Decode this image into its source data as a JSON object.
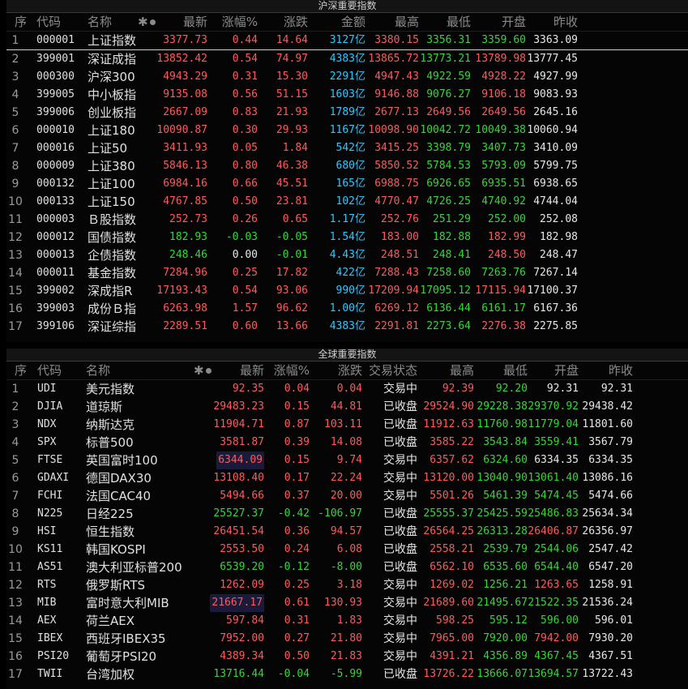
{
  "panel_cn": {
    "title": "沪深重要指数",
    "headers": {
      "seq": "序",
      "code": "代码",
      "name": "名称",
      "star": "✱",
      "last": "最新",
      "pct": "涨幅%",
      "chg": "涨跌",
      "amount": "金额",
      "high": "最高",
      "low": "最低",
      "open": "开盘",
      "prev": "昨收"
    },
    "rows": [
      [
        "1",
        "000001",
        "上证指数",
        "3377.73",
        "0.44",
        "14.64",
        "3127亿",
        "3380.15",
        "3356.31",
        "3359.60",
        "3363.09"
      ],
      [
        "2",
        "399001",
        "深证成指",
        "13852.42",
        "0.54",
        "74.97",
        "4383亿",
        "13865.72",
        "13773.21",
        "13789.98",
        "13777.45"
      ],
      [
        "3",
        "000300",
        "沪深300",
        "4943.29",
        "0.31",
        "15.30",
        "2291亿",
        "4947.43",
        "4922.59",
        "4928.22",
        "4927.99"
      ],
      [
        "4",
        "399005",
        "中小板指",
        "9135.08",
        "0.56",
        "51.15",
        "1603亿",
        "9146.88",
        "9076.27",
        "9106.18",
        "9083.93"
      ],
      [
        "5",
        "399006",
        "创业板指",
        "2667.09",
        "0.83",
        "21.93",
        "1789亿",
        "2677.13",
        "2649.56",
        "2649.56",
        "2645.16"
      ],
      [
        "6",
        "000010",
        "上证180",
        "10090.87",
        "0.30",
        "29.93",
        "1167亿",
        "10098.90",
        "10042.72",
        "10049.38",
        "10060.94"
      ],
      [
        "7",
        "000016",
        "上证50",
        "3411.93",
        "0.05",
        "1.84",
        "542亿",
        "3415.25",
        "3398.79",
        "3407.73",
        "3410.09"
      ],
      [
        "8",
        "000009",
        "上证380",
        "5846.13",
        "0.80",
        "46.38",
        "680亿",
        "5850.52",
        "5784.53",
        "5793.09",
        "5799.75"
      ],
      [
        "9",
        "000132",
        "上证100",
        "6984.16",
        "0.66",
        "45.51",
        "165亿",
        "6988.75",
        "6926.65",
        "6935.51",
        "6938.65"
      ],
      [
        "10",
        "000133",
        "上证150",
        "4767.85",
        "0.50",
        "23.81",
        "102亿",
        "4770.47",
        "4726.25",
        "4740.92",
        "4744.04"
      ],
      [
        "11",
        "000003",
        "Ｂ股指数",
        "252.73",
        "0.26",
        "0.65",
        "1.17亿",
        "252.76",
        "251.29",
        "252.00",
        "252.08"
      ],
      [
        "12",
        "000012",
        "国债指数",
        "182.93",
        "-0.03",
        "-0.05",
        "1.54亿",
        "183.00",
        "182.88",
        "182.99",
        "182.98"
      ],
      [
        "13",
        "000013",
        "企债指数",
        "248.46",
        "0.00",
        "-0.01",
        "4.43亿",
        "248.51",
        "248.41",
        "248.50",
        "248.47"
      ],
      [
        "14",
        "000011",
        "基金指数",
        "7284.96",
        "0.25",
        "17.82",
        "422亿",
        "7288.43",
        "7258.60",
        "7263.76",
        "7267.14"
      ],
      [
        "15",
        "399002",
        "深成指R",
        "17193.43",
        "0.54",
        "93.06",
        "990亿",
        "17209.94",
        "17095.12",
        "17115.94",
        "17100.37"
      ],
      [
        "16",
        "399003",
        "成份Ｂ指",
        "6263.98",
        "1.57",
        "96.62",
        "1.00亿",
        "6269.12",
        "6136.44",
        "6161.17",
        "6167.36"
      ],
      [
        "17",
        "399106",
        "深证综指",
        "2289.51",
        "0.60",
        "13.66",
        "4383亿",
        "2291.81",
        "2273.64",
        "2276.38",
        "2275.85"
      ]
    ]
  },
  "panel_global": {
    "title": "全球重要指数",
    "headers": {
      "seq": "序",
      "code": "代码",
      "name": "名称",
      "star": "✱",
      "last": "最新",
      "pct": "涨幅%",
      "chg": "涨跌",
      "status": "交易状态",
      "high": "最高",
      "low": "最低",
      "open": "开盘",
      "prev": "昨收"
    },
    "rows": [
      [
        "1",
        "UDI",
        "美元指数",
        "92.35",
        "0.04",
        "0.04",
        "交易中",
        "92.39",
        "92.20",
        "92.31",
        "92.31"
      ],
      [
        "2",
        "DJIA",
        "道琼斯",
        "29483.23",
        "0.15",
        "44.81",
        "已收盘",
        "29524.90",
        "29228.38",
        "29370.92",
        "29438.42"
      ],
      [
        "3",
        "NDX",
        "纳斯达克",
        "11904.71",
        "0.87",
        "103.11",
        "已收盘",
        "11912.63",
        "11760.98",
        "11779.04",
        "11801.60"
      ],
      [
        "4",
        "SPX",
        "标普500",
        "3581.87",
        "0.39",
        "14.08",
        "已收盘",
        "3585.22",
        "3543.84",
        "3559.41",
        "3567.79"
      ],
      [
        "5",
        "FTSE",
        "英国富时100",
        "6344.09",
        "0.15",
        "9.74",
        "交易中",
        "6357.62",
        "6324.60",
        "6334.35",
        "6334.35"
      ],
      [
        "6",
        "GDAXI",
        "德国DAX30",
        "13108.40",
        "0.17",
        "22.24",
        "交易中",
        "13120.00",
        "13040.90",
        "13061.40",
        "13086.16"
      ],
      [
        "7",
        "FCHI",
        "法国CAC40",
        "5494.66",
        "0.37",
        "20.00",
        "交易中",
        "5501.26",
        "5461.39",
        "5474.45",
        "5474.66"
      ],
      [
        "8",
        "N225",
        "日经225",
        "25527.37",
        "-0.42",
        "-106.97",
        "已收盘",
        "25555.37",
        "25425.59",
        "25486.83",
        "25634.34"
      ],
      [
        "9",
        "HSI",
        "恒生指数",
        "26451.54",
        "0.36",
        "94.57",
        "已收盘",
        "26564.25",
        "26313.28",
        "26406.87",
        "26356.97"
      ],
      [
        "10",
        "KS11",
        "韩国KOSPI",
        "2553.50",
        "0.24",
        "6.08",
        "已收盘",
        "2558.21",
        "2539.79",
        "2544.06",
        "2547.42"
      ],
      [
        "11",
        "AS51",
        "澳大利亚标普200",
        "6539.20",
        "-0.12",
        "-8.00",
        "已收盘",
        "6562.10",
        "6535.60",
        "6544.40",
        "6547.20"
      ],
      [
        "12",
        "RTS",
        "俄罗斯RTS",
        "1262.09",
        "0.25",
        "3.18",
        "交易中",
        "1269.02",
        "1256.21",
        "1263.65",
        "1258.91"
      ],
      [
        "13",
        "MIB",
        "富时意大利MIB",
        "21667.17",
        "0.61",
        "130.93",
        "交易中",
        "21689.60",
        "21495.67",
        "21522.35",
        "21536.24"
      ],
      [
        "14",
        "AEX",
        "荷兰AEX",
        "597.84",
        "0.31",
        "1.83",
        "交易中",
        "598.25",
        "595.12",
        "596.00",
        "596.01"
      ],
      [
        "15",
        "IBEX",
        "西班牙IBEX35",
        "7952.00",
        "0.27",
        "21.80",
        "交易中",
        "7965.00",
        "7920.00",
        "7942.00",
        "7930.20"
      ],
      [
        "16",
        "PSI20",
        "葡萄牙PSI20",
        "4389.34",
        "0.50",
        "21.83",
        "交易中",
        "4391.21",
        "4356.89",
        "4367.45",
        "4367.51"
      ],
      [
        "17",
        "TWII",
        "台湾加权",
        "13716.44",
        "-0.04",
        "-5.99",
        "已收盘",
        "13726.22",
        "13666.07",
        "13694.57",
        "13722.43"
      ]
    ]
  },
  "colors": {
    "up": "#ff5a5a",
    "down": "#35d735",
    "flat": "#e6e6e6",
    "amount": "#2ec8ff",
    "highlight_name": "#3fa7ff"
  }
}
